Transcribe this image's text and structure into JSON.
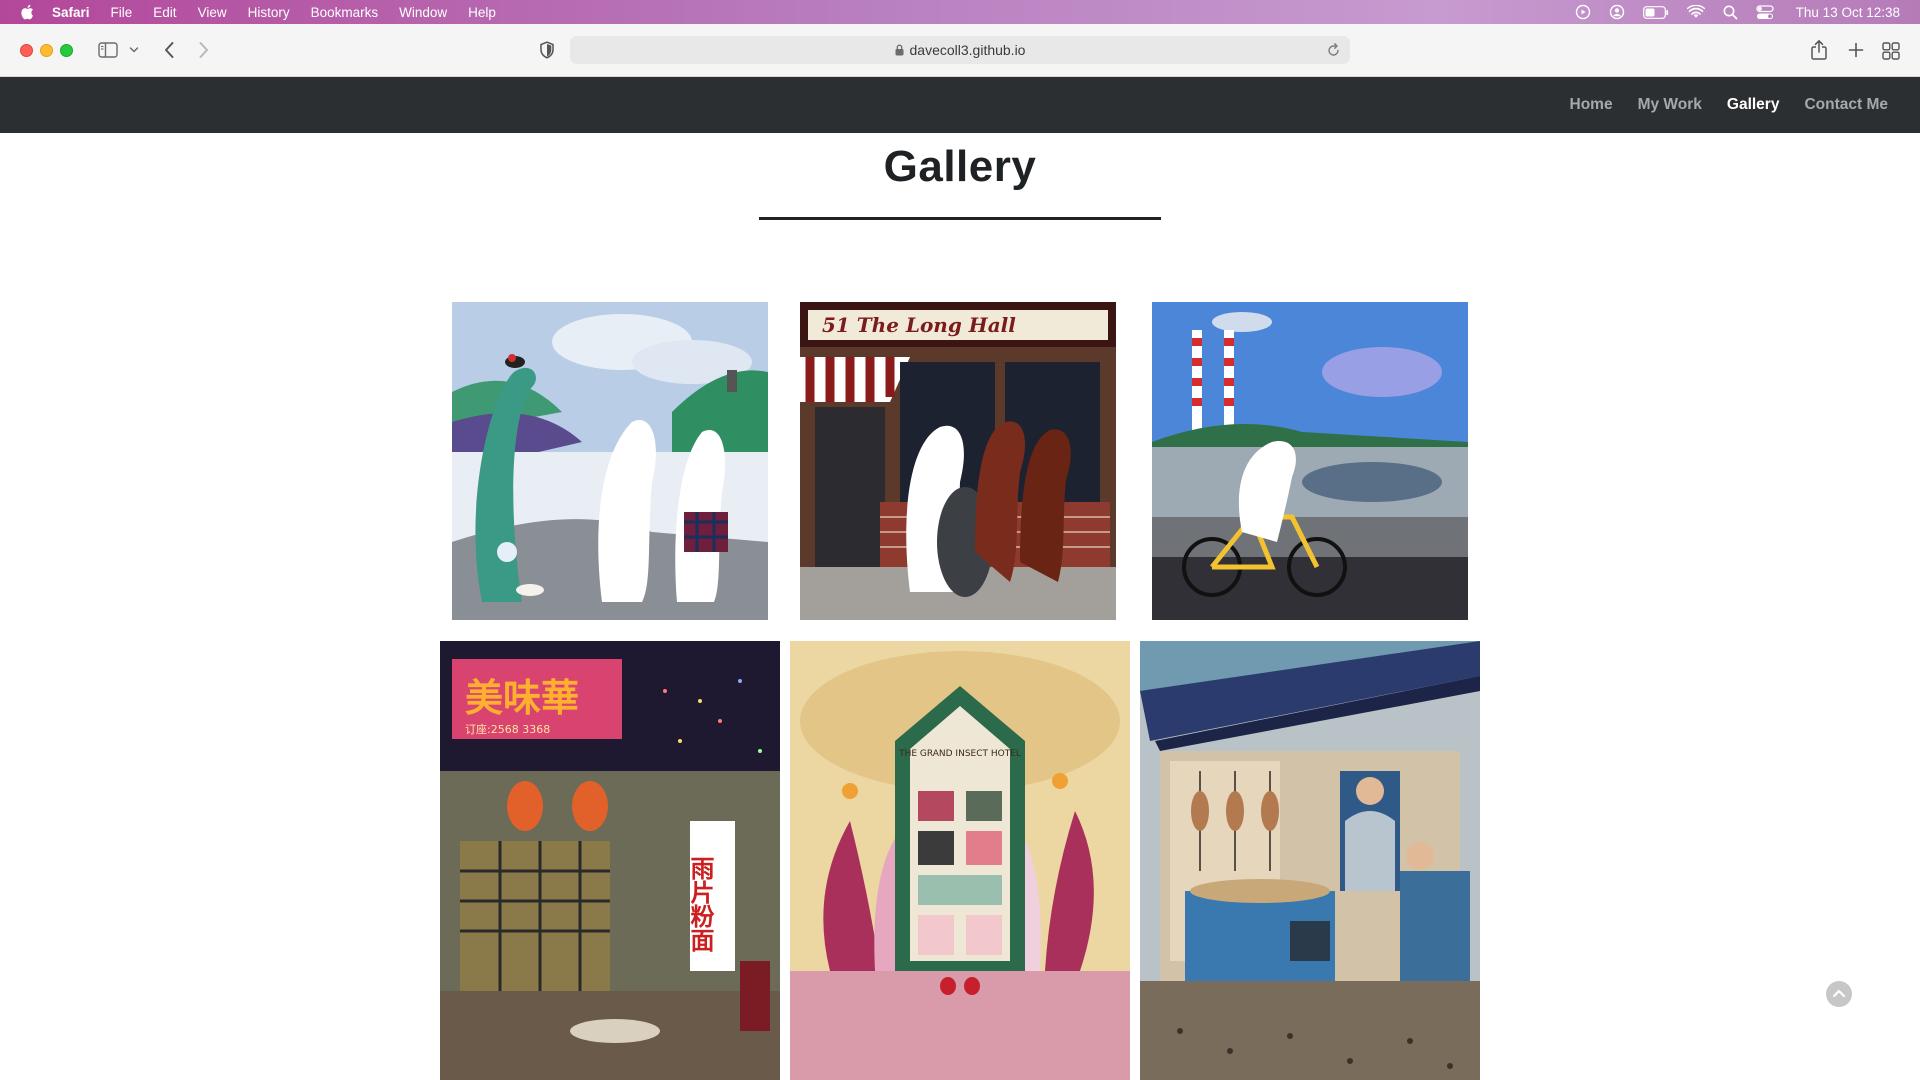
{
  "menubar": {
    "app_name": "Safari",
    "items": [
      "File",
      "Edit",
      "View",
      "History",
      "Bookmarks",
      "Window",
      "Help"
    ],
    "clock": "Thu 13 Oct  12:38",
    "icons": [
      "apple-icon",
      "screen-record-icon",
      "user-icon",
      "battery-icon",
      "wifi-icon",
      "spotlight-search-icon",
      "control-center-icon"
    ]
  },
  "browser": {
    "url": "davecoll3.github.io",
    "icons": [
      "sidebar-icon",
      "chevron-down-icon",
      "back-icon",
      "forward-icon",
      "privacy-shield-icon",
      "lock-icon",
      "reload-icon",
      "share-icon",
      "new-tab-icon",
      "tab-overview-icon"
    ]
  },
  "nav": {
    "links": [
      {
        "label": "Home",
        "active": false
      },
      {
        "label": "My Work",
        "active": false
      },
      {
        "label": "Gallery",
        "active": true
      },
      {
        "label": "Contact Me",
        "active": false
      }
    ]
  },
  "page": {
    "title": "Gallery"
  },
  "gallery": {
    "tiles": [
      {
        "name": "gallery-image-loch-ness-tea"
      },
      {
        "name": "gallery-image-long-hall-pub",
        "sign_text": "51  The Long Hall"
      },
      {
        "name": "gallery-image-bicycle-chimneys"
      },
      {
        "name": "gallery-image-neon-street",
        "sign_text": "美味華",
        "phone_text": "订座:2568 3368",
        "banner_text": "雨片粉面"
      },
      {
        "name": "gallery-image-insect-hotel",
        "sign_text": "THE GRAND INSECT HOTEL"
      },
      {
        "name": "gallery-image-market-stall"
      }
    ]
  },
  "colors": {
    "nav_bg": "#2b2f31",
    "nav_link": "#a5a9ad",
    "nav_active": "#ffffff",
    "menubar_gradient_start": "#b4479a"
  }
}
